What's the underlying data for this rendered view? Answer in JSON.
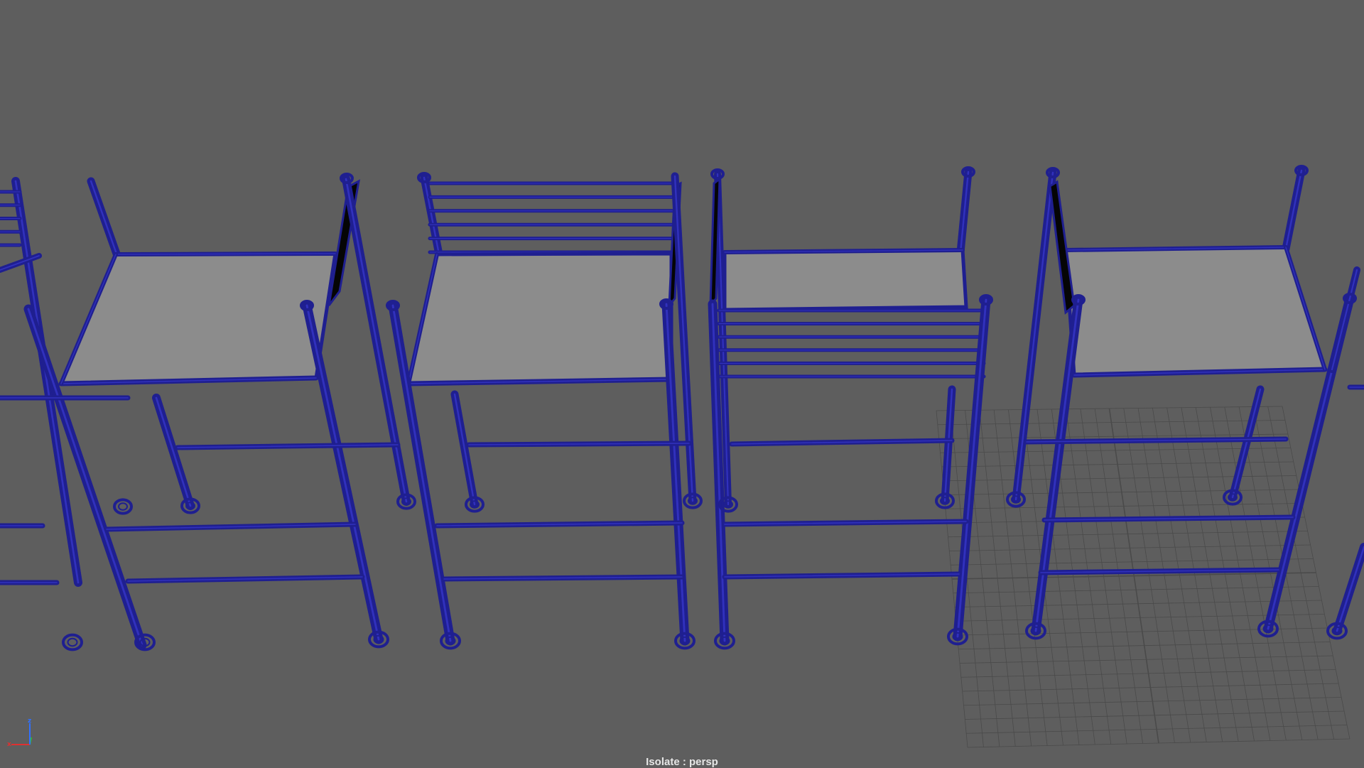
{
  "viewport": {
    "camera_label": "Isolate : persp",
    "background_color": "#5e5e5e",
    "wire_color": "#1f1f90",
    "seat_color": "#8c8c8c",
    "backrest_color": "#050505",
    "grid_color": "#4a4a4a"
  },
  "axis_indicator": {
    "x_label": "x",
    "y_label": "y",
    "z_label": "z",
    "x_color": "#e03030",
    "y_color": "#30c030",
    "z_color": "#3070ff"
  }
}
